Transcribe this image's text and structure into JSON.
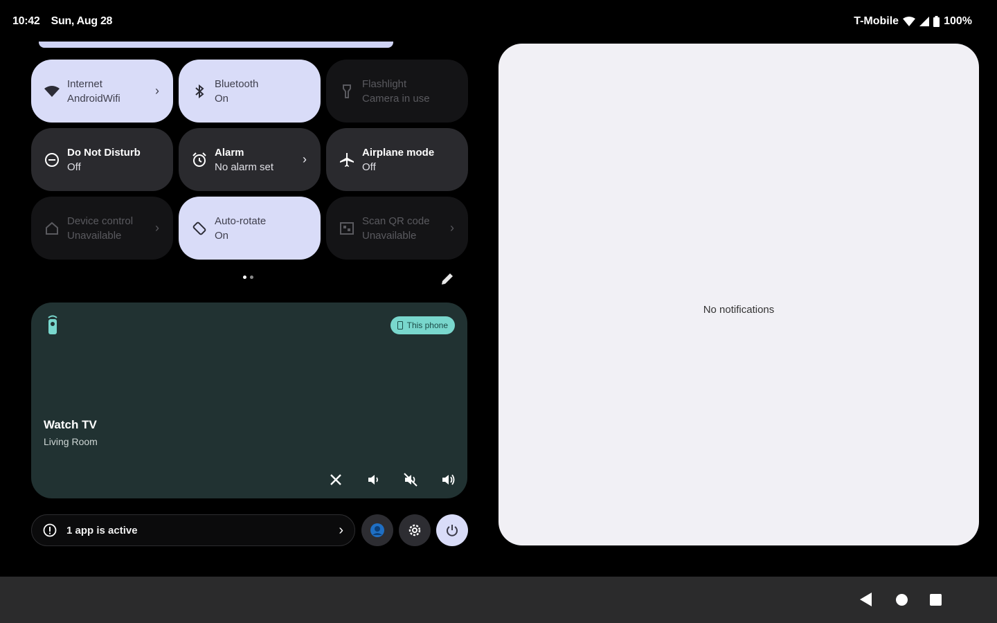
{
  "status_bar": {
    "time": "10:42",
    "date": "Sun, Aug 28",
    "carrier": "T-Mobile",
    "battery": "100%"
  },
  "tiles": [
    {
      "label": "Internet",
      "sub": "AndroidWifi",
      "state": "active",
      "icon": "wifi-icon",
      "chevron": true
    },
    {
      "label": "Bluetooth",
      "sub": "On",
      "state": "active",
      "icon": "bluetooth-icon",
      "chevron": false
    },
    {
      "label": "Flashlight",
      "sub": "Camera in use",
      "state": "unavailable",
      "icon": "flashlight-icon",
      "chevron": false
    },
    {
      "label": "Do Not Disturb",
      "sub": "Off",
      "state": "inactive",
      "icon": "do-not-disturb-icon",
      "chevron": false
    },
    {
      "label": "Alarm",
      "sub": "No alarm set",
      "state": "inactive",
      "icon": "alarm-icon",
      "chevron": true
    },
    {
      "label": "Airplane mode",
      "sub": "Off",
      "state": "inactive",
      "icon": "airplane-icon",
      "chevron": false
    },
    {
      "label": "Device control",
      "sub": "Unavailable",
      "state": "unavailable",
      "icon": "home-icon",
      "chevron": true
    },
    {
      "label": "Auto-rotate",
      "sub": "On",
      "state": "active",
      "icon": "rotate-icon",
      "chevron": false
    },
    {
      "label": "Scan QR code",
      "sub": "Unavailable",
      "state": "unavailable",
      "icon": "qr-icon",
      "chevron": true
    }
  ],
  "media": {
    "output_chip": "This phone",
    "title": "Watch TV",
    "subtitle": "Living Room"
  },
  "footer": {
    "active_apps": "1 app is active"
  },
  "notifications": {
    "empty_text": "No notifications"
  }
}
